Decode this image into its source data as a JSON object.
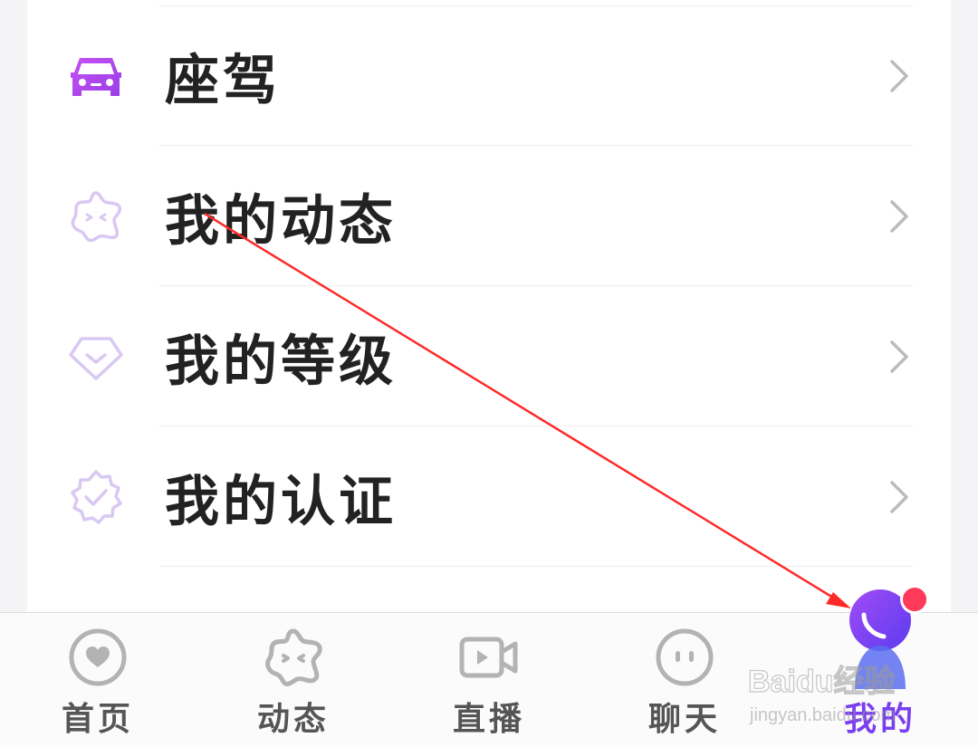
{
  "menu": {
    "items": [
      {
        "label": "座驾",
        "icon": "car-icon",
        "color": "#b44cf0"
      },
      {
        "label": "我的动态",
        "icon": "star-face-icon",
        "color": "#d9c8f2"
      },
      {
        "label": "我的等级",
        "icon": "diamond-icon",
        "color": "#d9c8f2"
      },
      {
        "label": "我的认证",
        "icon": "verified-badge-icon",
        "color": "#d9c8f2"
      }
    ]
  },
  "tabbar": {
    "tabs": [
      {
        "label": "首页",
        "icon": "heart-bubble-icon",
        "active": false
      },
      {
        "label": "动态",
        "icon": "star-face-icon",
        "active": false
      },
      {
        "label": "直播",
        "icon": "video-camera-icon",
        "active": false
      },
      {
        "label": "聊天",
        "icon": "chat-face-icon",
        "active": false
      },
      {
        "label": "我的",
        "icon": "profile-avatar-icon",
        "active": true
      }
    ],
    "active_color": "#7a3ff0",
    "notification_color": "#ff3a58"
  },
  "watermark": {
    "brand": "Baidu经验",
    "url": "jingyan.baidu.com"
  },
  "annotation": {
    "arrow_color": "#ff2a2a"
  }
}
